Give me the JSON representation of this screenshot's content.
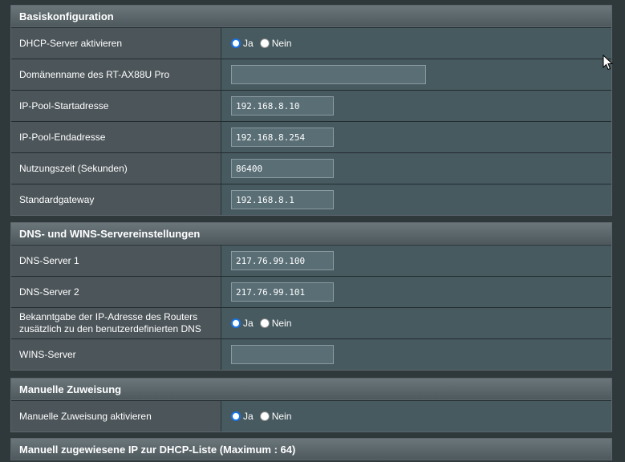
{
  "sections": {
    "basic": {
      "title": "Basiskonfiguration",
      "rows": {
        "dhcp_enable": {
          "label": "DHCP-Server aktivieren",
          "yes": "Ja",
          "no": "Nein"
        },
        "domain": {
          "label": "Domänenname des RT-AX88U Pro",
          "value": ""
        },
        "pool_start": {
          "label": "IP-Pool-Startadresse",
          "value": "192.168.8.10"
        },
        "pool_end": {
          "label": "IP-Pool-Endadresse",
          "value": "192.168.8.254"
        },
        "lease": {
          "label": "Nutzungszeit (Sekunden)",
          "value": "86400"
        },
        "gateway": {
          "label": "Standardgateway",
          "value": "192.168.8.1"
        }
      }
    },
    "dns": {
      "title": "DNS- und WINS-Servereinstellungen",
      "rows": {
        "dns1": {
          "label": "DNS-Server 1",
          "value": "217.76.99.100"
        },
        "dns2": {
          "label": "DNS-Server 2",
          "value": "217.76.99.101"
        },
        "advertise": {
          "label_line1": "Bekanntgabe der IP-Adresse des Routers",
          "label_line2": "zusätzlich zu den benutzerdefinierten DNS",
          "yes": "Ja",
          "no": "Nein"
        },
        "wins": {
          "label": "WINS-Server",
          "value": ""
        }
      }
    },
    "manual": {
      "title": "Manuelle Zuweisung",
      "rows": {
        "enable": {
          "label": "Manuelle Zuweisung aktivieren",
          "yes": "Ja",
          "no": "Nein"
        }
      }
    },
    "list": {
      "title": "Manuell zugewiesene IP zur DHCP-Liste (Maximum : 64)"
    }
  },
  "icons": {
    "cursor": "mouse-pointer-icon"
  }
}
